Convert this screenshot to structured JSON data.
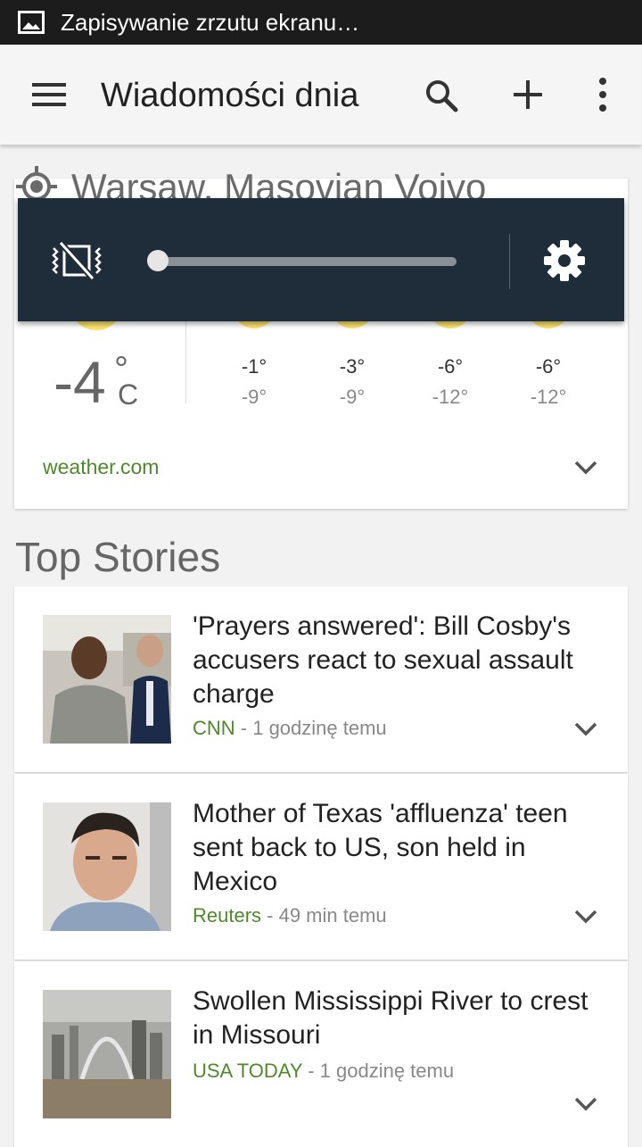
{
  "status_bar": {
    "notification": "Zapisywanie zrzutu ekranu…"
  },
  "app_bar": {
    "title": "Wiadomości dnia"
  },
  "weather": {
    "location": "Warsaw, Masovian Voivo",
    "current_temp": "-4",
    "degree_symbol": "°",
    "unit": "C",
    "forecast": [
      {
        "high": "-1°",
        "low": "-9°"
      },
      {
        "high": "-3°",
        "low": "-9°"
      },
      {
        "high": "-6°",
        "low": "-12°"
      },
      {
        "high": "-6°",
        "low": "-12°"
      }
    ],
    "source": "weather.com"
  },
  "volume_popup": {
    "level": 0
  },
  "top_stories": {
    "title": "Top Stories",
    "items": [
      {
        "headline": "'Prayers answered': Bill Cosby's accusers react to sexual assault charge",
        "source": "CNN",
        "time": " - 1 godzinę temu"
      },
      {
        "headline": "Mother of Texas 'affluenza' teen sent back to US, son held in Mexico",
        "source": "Reuters",
        "time": " - 49 min temu"
      },
      {
        "headline": "Swollen Mississippi River to crest in Missouri",
        "source": "USA TODAY",
        "time": " - 1 godzinę temu"
      }
    ]
  },
  "colors": {
    "accent_green": "#4e8a2a",
    "popup_bg": "#1f2d3a",
    "sun_yellow": "#fde36e"
  }
}
